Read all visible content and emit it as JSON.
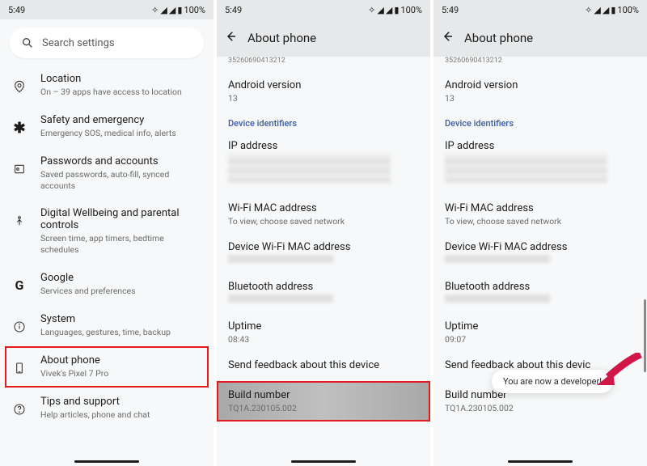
{
  "status": {
    "time": "5:49",
    "battery": "100%"
  },
  "panel1": {
    "search_placeholder": "Search settings",
    "rows": [
      {
        "title": "Location",
        "sub": "On – 39 apps have access to location"
      },
      {
        "title": "Safety and emergency",
        "sub": "Emergency SOS, medical info, alerts"
      },
      {
        "title": "Passwords and accounts",
        "sub": "Saved passwords, auto-fill, synced accounts"
      },
      {
        "title": "Digital Wellbeing and parental controls",
        "sub": "Screen time, app timers, bedtime schedules"
      },
      {
        "title": "Google",
        "sub": "Services and preferences"
      },
      {
        "title": "System",
        "sub": "Languages, gestures, time, backup"
      },
      {
        "title": "About phone",
        "sub": "Vivek's Pixel 7 Pro"
      },
      {
        "title": "Tips and support",
        "sub": "Help articles, phone and chat"
      }
    ]
  },
  "about": {
    "title": "About phone",
    "truncated_id": "35260690413212",
    "android_label": "Android version",
    "android_val": "13",
    "section": "Device identifiers",
    "ip_label": "IP address",
    "wifi_mac_label": "Wi-Fi MAC address",
    "wifi_mac_sub": "To view, choose saved network",
    "dev_wifi_mac_label": "Device Wi-Fi MAC address",
    "bt_label": "Bluetooth address",
    "uptime_label": "Uptime",
    "uptime_p2": "08:43",
    "uptime_p3": "09:07",
    "feedback_label": "Send feedback about this device",
    "feedback_label_trunc": "Send feedback about this devic",
    "build_label": "Build number",
    "build_val": "TQ1A.230105.002"
  },
  "toast": {
    "msg": "You are now a developer!"
  }
}
